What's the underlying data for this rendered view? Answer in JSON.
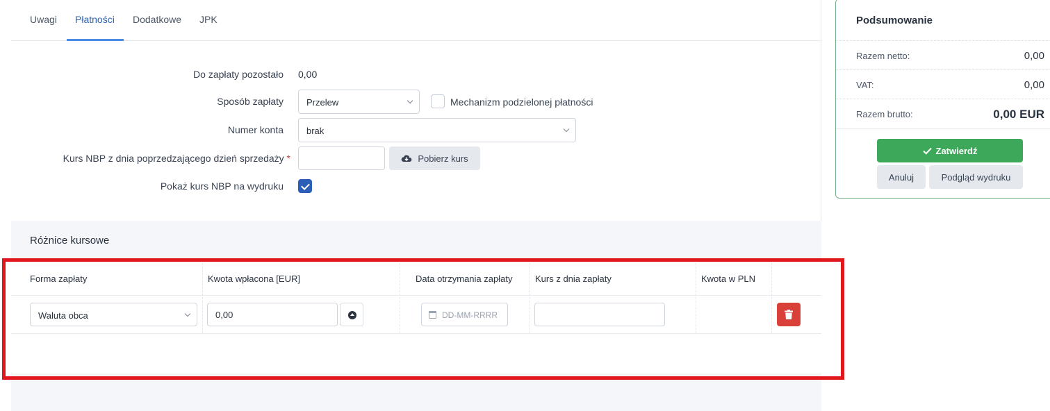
{
  "tabs": [
    "Uwagi",
    "Płatności",
    "Dodatkowe",
    "JPK"
  ],
  "form": {
    "remaining_label": "Do zapłaty pozostało",
    "remaining_value": "0,00",
    "payment_method_label": "Sposób zapłaty",
    "payment_method_value": "Przelew",
    "split_payment_label": "Mechanizm podzielonej płatności",
    "account_label": "Numer konta",
    "account_value": "brak",
    "nbp_rate_label": "Kurs NBP z dnia poprzedzającego dzień sprzedaży",
    "required_mark": "*",
    "nbp_rate_value": "",
    "fetch_rate_button": "Pobierz kurs",
    "show_rate_label": "Pokaż kurs NBP na wydruku"
  },
  "section": {
    "title": "Różnice kursowe",
    "columns": [
      "Forma zapłaty",
      "Kwota wpłacona [EUR]",
      "Data otrzymania zapłaty",
      "Kurs z dnia zapłaty",
      "Kwota w PLN"
    ],
    "row": {
      "payment_form": "Waluta obca",
      "amount": "0,00",
      "date_placeholder": "DD-MM-RRRR",
      "rate": "",
      "pln": ""
    }
  },
  "summary": {
    "title": "Podsumowanie",
    "net_label": "Razem netto:",
    "net_value": "0,00",
    "vat_label": "VAT:",
    "vat_value": "0,00",
    "gross_label": "Razem brutto:",
    "gross_value": "0,00 EUR",
    "confirm_button": "Zatwierdź",
    "cancel_button": "Anuluj",
    "preview_button": "Podgląd wydruku"
  },
  "colors": {
    "accent": "#2f64b5",
    "confirm_green": "#3da85a",
    "delete_red": "#d9403a",
    "highlight_red": "#e0181e"
  }
}
